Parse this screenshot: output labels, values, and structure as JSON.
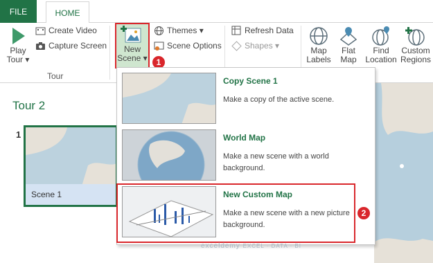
{
  "tabs": {
    "file": "FILE",
    "home": "HOME"
  },
  "tour_group": {
    "play_tour": [
      "Play",
      "Tour"
    ],
    "create_video": "Create Video",
    "capture_screen": "Capture Screen",
    "label": "Tour"
  },
  "scene_group": {
    "new_scene": [
      "New",
      "Scene"
    ],
    "themes": "Themes",
    "scene_options": "Scene Options"
  },
  "layer_group": {
    "refresh_data": "Refresh Data",
    "shapes": "Shapes"
  },
  "map_group": {
    "map_labels": [
      "Map",
      "Labels"
    ],
    "flat_map": [
      "Flat",
      "Map"
    ],
    "find_location": [
      "Find",
      "Location"
    ],
    "custom_regions": [
      "Custom",
      "Regions"
    ]
  },
  "tour_panel": {
    "title": "Tour 2",
    "scene_number": "1",
    "scene_label": "Scene 1"
  },
  "menu": {
    "items": [
      {
        "title": "Copy Scene 1",
        "desc": "Make a copy of the active scene."
      },
      {
        "title": "World Map",
        "desc": "Make a new scene with a world background."
      },
      {
        "title": "New Custom Map",
        "desc": "Make a new scene with a new picture background."
      }
    ]
  },
  "badges": [
    "1",
    "2"
  ],
  "watermark": "exceldemy",
  "watermark_sub": "EXCEL · DATA · BI",
  "colors": {
    "accent": "#217346",
    "highlight": "#d9262b",
    "selected_bg": "#cfe6cf",
    "map_water": "#b6cfdd"
  }
}
